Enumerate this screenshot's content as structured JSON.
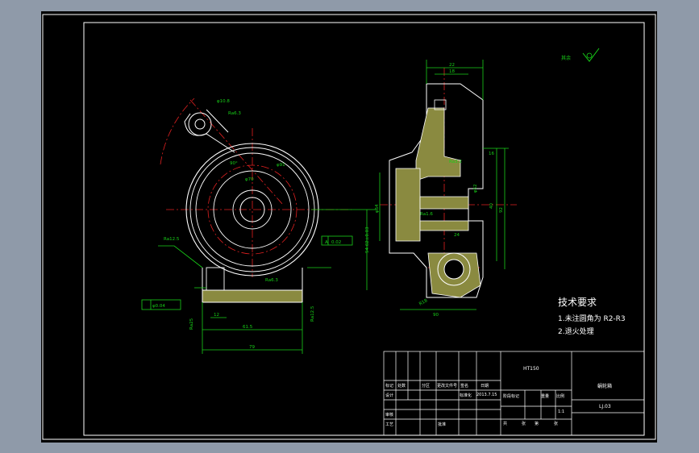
{
  "tech_requirements": {
    "title": "技术要求",
    "line1": "1.未注圆角为 R2-R3",
    "line2": "2.退火处理"
  },
  "title_block": {
    "material": "HT150",
    "part_name": "蜗轮箱",
    "drawing_no": "LJ.03",
    "scale": "1:1",
    "labels": {
      "mark": "标记",
      "count": "处数",
      "zone": "分区",
      "change_doc": "更改文件号",
      "signature": "签名",
      "date": "日期",
      "designer": "设计",
      "standardize": "标准化",
      "stage_mark": "阶段标记",
      "weight": "重量",
      "scale": "比例",
      "reviewer": "审核",
      "process": "工艺",
      "approve": "批准",
      "sheets_total": "共",
      "sheet": "张",
      "sheet_no": "第"
    },
    "date_value": "2013.7.15"
  },
  "roughness_note": "其余",
  "front_view_dims": {
    "d10_8": "φ10.8",
    "ra6_3_top": "Ra6.3",
    "d70": "φ70",
    "d91": "φ91",
    "angle90": "90°",
    "ra12_5_left": "Ra12.5",
    "datum_a": "A",
    "flatness": "0.02",
    "h54": "54.62±0.03",
    "dim_12": "12",
    "dim_61_5": "61.5",
    "dim_79": "79",
    "ra25": "Ra25",
    "ra12_5_bottom": "Ra12.5",
    "ra6_3_bottom": "Ra6.3",
    "tol_box": "φ0.04"
  },
  "side_view_dims": {
    "dim_22": "22",
    "dim_18": "18",
    "dim_90": "90",
    "dim_24": "24",
    "dim_92": "92",
    "dim_16": "16",
    "dim_40": "40",
    "ra3_2": "Ra3.2",
    "ra1_6": "Ra1.6",
    "r18": "R18",
    "d64": "φ64",
    "d52": "φ52"
  }
}
